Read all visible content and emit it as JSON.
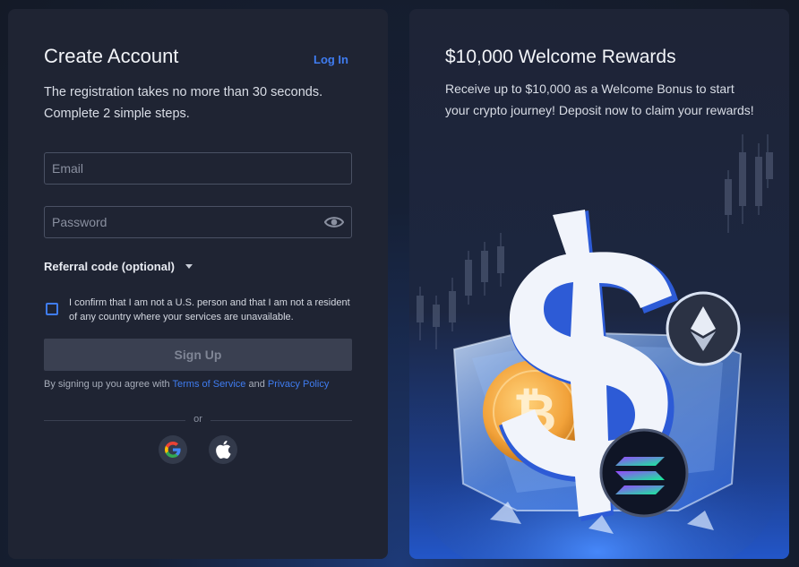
{
  "signup": {
    "title": "Create Account",
    "login_link": "Log In",
    "subtitle": "The registration takes no more than 30 seconds. Complete 2 simple steps.",
    "email_placeholder": "Email",
    "password_placeholder": "Password",
    "referral_label": "Referral code (optional)",
    "confirm_text": "I confirm that I am not a U.S. person and that I am not a resident of any country where your services are unavailable.",
    "signup_button": "Sign Up",
    "terms_prefix": "By signing up you agree with ",
    "terms_link": "Terms of Service",
    "terms_and": " and ",
    "privacy_link": "Privacy Policy",
    "or_label": "or",
    "social": [
      "google-icon",
      "apple-icon"
    ]
  },
  "promo": {
    "title": "$10,000 Welcome Rewards",
    "text": "Receive up to $10,000 as a Welcome Bonus to start your crypto journey! Deposit now to claim your rewards!"
  },
  "colors": {
    "accent": "#3f7cf0",
    "card_bg": "#1f2433",
    "button_disabled": "#3a4051"
  }
}
